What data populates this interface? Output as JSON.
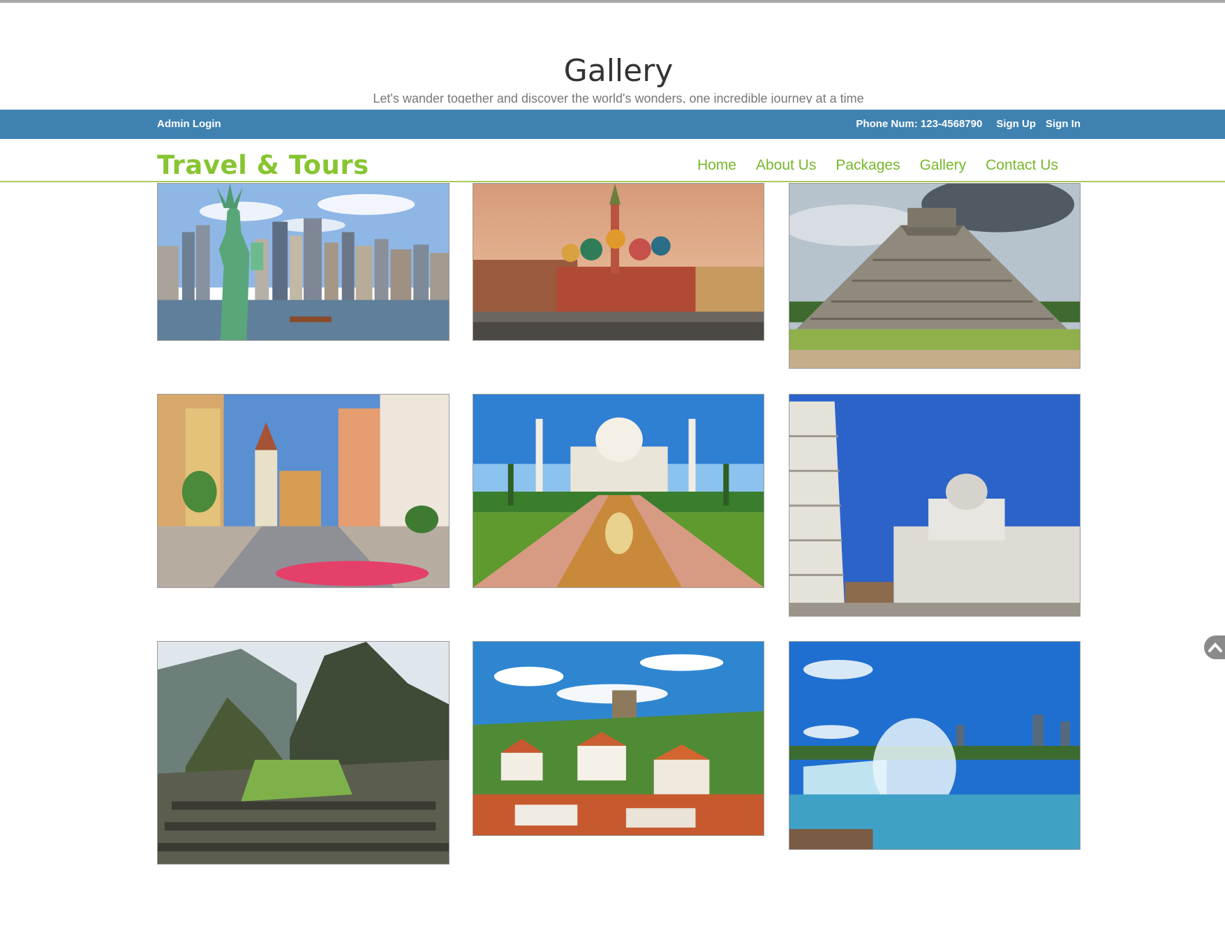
{
  "page": {
    "title": "Gallery",
    "subtitle": "Let's wander together and discover the world's wonders, one incredible journey at a time"
  },
  "topbar": {
    "admin_login": "Admin Login",
    "phone": "Phone Num: 123-4568790",
    "sign_up": "Sign Up",
    "sign_in": "Sign In",
    "background_color": "#3f82b2"
  },
  "brand": {
    "logo_text": "Travel & Tours",
    "accent_color": "#87c531"
  },
  "nav": {
    "items": [
      "Home",
      "About Us",
      "Packages",
      "Gallery",
      "Contact Us"
    ]
  },
  "gallery": {
    "images": [
      {
        "alt": "Statue of Liberty and New York skyline"
      },
      {
        "alt": "Saint Basil's Cathedral, Moscow"
      },
      {
        "alt": "Chichen Itza pyramid"
      },
      {
        "alt": "Rothenburg old town street"
      },
      {
        "alt": "Taj Mahal"
      },
      {
        "alt": "Leaning Tower of Pisa and Cathedral"
      },
      {
        "alt": "Machu Picchu"
      },
      {
        "alt": "Hilltop village with castle"
      },
      {
        "alt": "Niagara Falls"
      }
    ]
  },
  "scroll_top_icon": "chevron-up-icon"
}
